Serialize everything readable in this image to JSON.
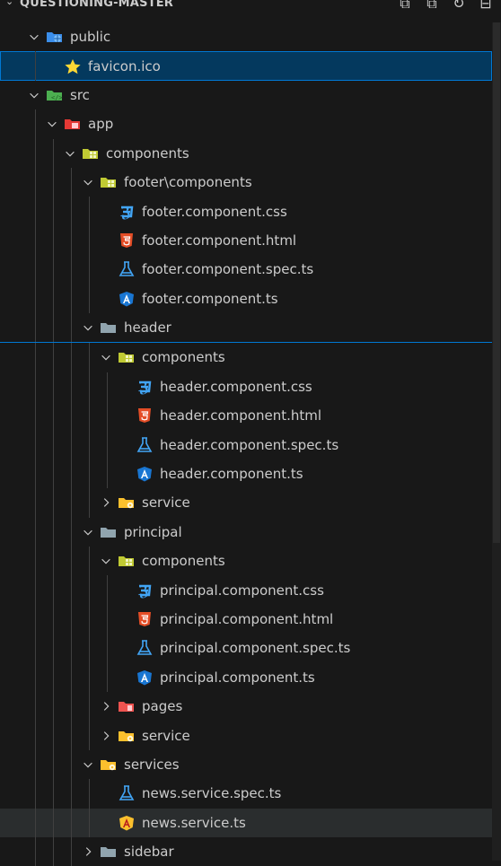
{
  "explorer": {
    "title": "QUESTIONING-MASTER",
    "actions": [
      {
        "name": "new-file-icon",
        "glyph": "⊞"
      },
      {
        "name": "new-folder-icon",
        "glyph": "⊞"
      },
      {
        "name": "refresh-icon",
        "glyph": "↻"
      },
      {
        "name": "collapse-all-icon",
        "glyph": "⊟"
      }
    ]
  },
  "tree": [
    {
      "label": "public",
      "depth": 1,
      "type": "folder",
      "open": true,
      "icon": "globe-folder-icon"
    },
    {
      "label": "favicon.ico",
      "depth": 2,
      "type": "file",
      "icon": "star-icon",
      "state": "selected"
    },
    {
      "label": "src",
      "depth": 1,
      "type": "folder",
      "open": true,
      "icon": "src-folder-icon"
    },
    {
      "label": "app",
      "depth": 2,
      "type": "folder",
      "open": true,
      "icon": "app-folder-icon"
    },
    {
      "label": "components",
      "depth": 3,
      "type": "folder",
      "open": true,
      "icon": "components-folder-icon"
    },
    {
      "label": "footer\\components",
      "depth": 4,
      "type": "folder",
      "open": true,
      "icon": "components-folder-icon"
    },
    {
      "label": "footer.component.css",
      "depth": 5,
      "type": "file",
      "icon": "css-icon"
    },
    {
      "label": "footer.component.html",
      "depth": 5,
      "type": "file",
      "icon": "html-icon"
    },
    {
      "label": "footer.component.spec.ts",
      "depth": 5,
      "type": "file",
      "icon": "test-flask-icon"
    },
    {
      "label": "footer.component.ts",
      "depth": 5,
      "type": "file",
      "icon": "angular-icon"
    },
    {
      "label": "header",
      "depth": 4,
      "type": "folder",
      "open": true,
      "icon": "plain-folder-icon"
    },
    {
      "label": "components",
      "depth": 5,
      "type": "folder",
      "open": true,
      "icon": "components-folder-icon",
      "state": "focusline"
    },
    {
      "label": "header.component.css",
      "depth": 6,
      "type": "file",
      "icon": "css-icon"
    },
    {
      "label": "header.component.html",
      "depth": 6,
      "type": "file",
      "icon": "html-icon"
    },
    {
      "label": "header.component.spec.ts",
      "depth": 6,
      "type": "file",
      "icon": "test-flask-icon"
    },
    {
      "label": "header.component.ts",
      "depth": 6,
      "type": "file",
      "icon": "angular-icon"
    },
    {
      "label": "service",
      "depth": 5,
      "type": "folder",
      "open": false,
      "icon": "service-folder-icon"
    },
    {
      "label": "principal",
      "depth": 4,
      "type": "folder",
      "open": true,
      "icon": "plain-folder-icon"
    },
    {
      "label": "components",
      "depth": 5,
      "type": "folder",
      "open": true,
      "icon": "components-folder-icon"
    },
    {
      "label": "principal.component.css",
      "depth": 6,
      "type": "file",
      "icon": "css-icon"
    },
    {
      "label": "principal.component.html",
      "depth": 6,
      "type": "file",
      "icon": "html-icon"
    },
    {
      "label": "principal.component.spec.ts",
      "depth": 6,
      "type": "file",
      "icon": "test-flask-icon"
    },
    {
      "label": "principal.component.ts",
      "depth": 6,
      "type": "file",
      "icon": "angular-icon"
    },
    {
      "label": "pages",
      "depth": 5,
      "type": "folder",
      "open": false,
      "icon": "pages-folder-icon"
    },
    {
      "label": "service",
      "depth": 5,
      "type": "folder",
      "open": false,
      "icon": "service-folder-icon"
    },
    {
      "label": "services",
      "depth": 4,
      "type": "folder",
      "open": true,
      "icon": "service-folder-icon"
    },
    {
      "label": "news.service.spec.ts",
      "depth": 5,
      "type": "file",
      "icon": "test-flask-icon"
    },
    {
      "label": "news.service.ts",
      "depth": 5,
      "type": "file",
      "icon": "angular-service-icon",
      "state": "hover"
    },
    {
      "label": "sidebar",
      "depth": 4,
      "type": "folder",
      "open": false,
      "icon": "plain-folder-icon"
    }
  ],
  "colors": {
    "background": "#181818",
    "text": "#cccccc",
    "selected_bg": "#04395e",
    "focus_border": "#0078d4",
    "hover_bg": "#2a2d2e"
  }
}
